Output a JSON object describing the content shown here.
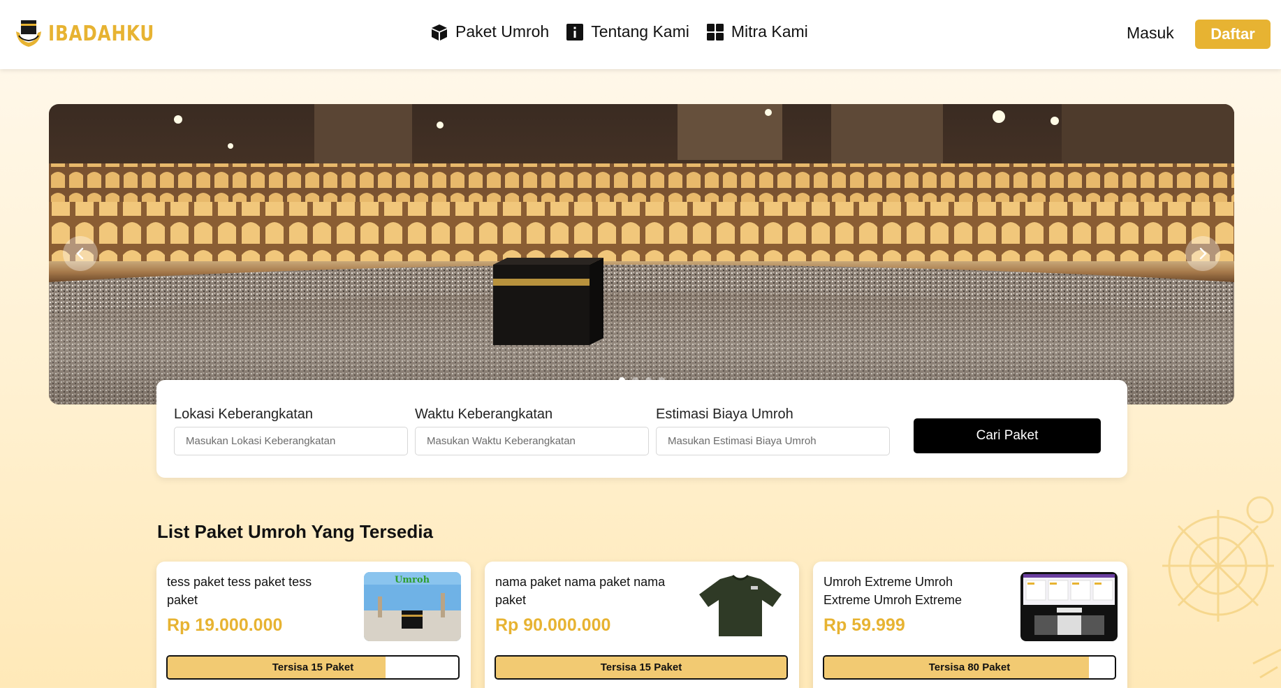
{
  "brand": {
    "name": "IBADAHKU",
    "color": "#e7b332",
    "logo_icon": "kaaba-hands-icon"
  },
  "nav": {
    "items": [
      {
        "label": "Paket Umroh",
        "icon": "box-icon"
      },
      {
        "label": "Tentang Kami",
        "icon": "info-icon"
      },
      {
        "label": "Mitra Kami",
        "icon": "grid-icon"
      }
    ],
    "login_label": "Masuk",
    "register_label": "Daftar"
  },
  "hero": {
    "image": "masjidil-haram-kaaba-photo",
    "prev_icon": "chevron-left-icon",
    "next_icon": "chevron-right-icon",
    "slide_count": 4,
    "active_slide": 1
  },
  "search": {
    "fields": [
      {
        "label": "Lokasi Keberangkatan",
        "placeholder": "Masukan Lokasi Keberangkatan"
      },
      {
        "label": "Waktu Keberangkatan",
        "placeholder": "Masukan Waktu Keberangkatan"
      },
      {
        "label": "Estimasi Biaya Umroh",
        "placeholder": "Masukan Estimasi Biaya Umroh"
      }
    ],
    "button_label": "Cari Paket"
  },
  "packages": {
    "title": "List Paket Umroh Yang Tersedia",
    "items": [
      {
        "name": "tess paket tess paket tess paket",
        "price": "Rp 19.000.000",
        "remaining_label": "Tersisa 15 Paket",
        "fill_fraction": 0.75,
        "thumb": "umroh-kaaba-image"
      },
      {
        "name": "nama paket nama paket nama paket",
        "price": "Rp 90.000.000",
        "remaining_label": "Tersisa 15 Paket",
        "fill_fraction": 1.0,
        "thumb": "dark-shirt-image"
      },
      {
        "name": "Umroh Extreme Umroh Extreme Umroh Extreme",
        "price": "Rp 59.999",
        "remaining_label": "Tersisa 80 Paket",
        "fill_fraction": 0.91,
        "thumb": "dashboard-screenshot-image"
      }
    ]
  },
  "colors": {
    "accent": "#e7b332",
    "progress_fill": "#f2ca72",
    "button_dark": "#000000"
  }
}
